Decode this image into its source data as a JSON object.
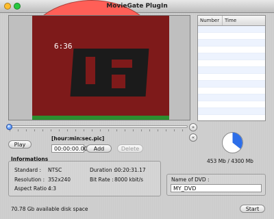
{
  "window": {
    "title": "MovieGate PlugIn"
  },
  "preview": {
    "timestamp": "6:36"
  },
  "markers_table": {
    "columns": [
      "Number",
      "Time"
    ],
    "rows": []
  },
  "controls": {
    "play_label": "Play",
    "time_format_label": "[hour:min:sec.pic]",
    "time_value": "00:00:00.00",
    "add_label": "Add",
    "delete_label": "Delete"
  },
  "size": {
    "used_mb": 453,
    "total_mb": 4300,
    "label": "453 Mb / 4300 Mb"
  },
  "info": {
    "title": "Informations",
    "standard_label": "Standard :",
    "standard_value": "NTSC",
    "resolution_label": "Resolution :",
    "resolution_value": "352x240",
    "aspect_label": "Aspect Ratio :",
    "aspect_value": "4:3",
    "duration_label": "Duration :",
    "duration_value": "00:20:31.17",
    "bitrate_label": "Bit Rate :",
    "bitrate_value": "8000 kbit/s"
  },
  "dvd": {
    "name_label": "Name of DVD :",
    "name_value": "MY_DVD"
  },
  "status": {
    "disk_space": "70.78 Gb available disk space"
  },
  "start_label": "Start",
  "icons": {
    "fast_forward": "fast-forward-icon",
    "rewind": "rewind-icon"
  },
  "colors": {
    "accent": "#2d6ee8",
    "video_red": "#7e1a1a",
    "video_green": "#2c8e2f"
  }
}
